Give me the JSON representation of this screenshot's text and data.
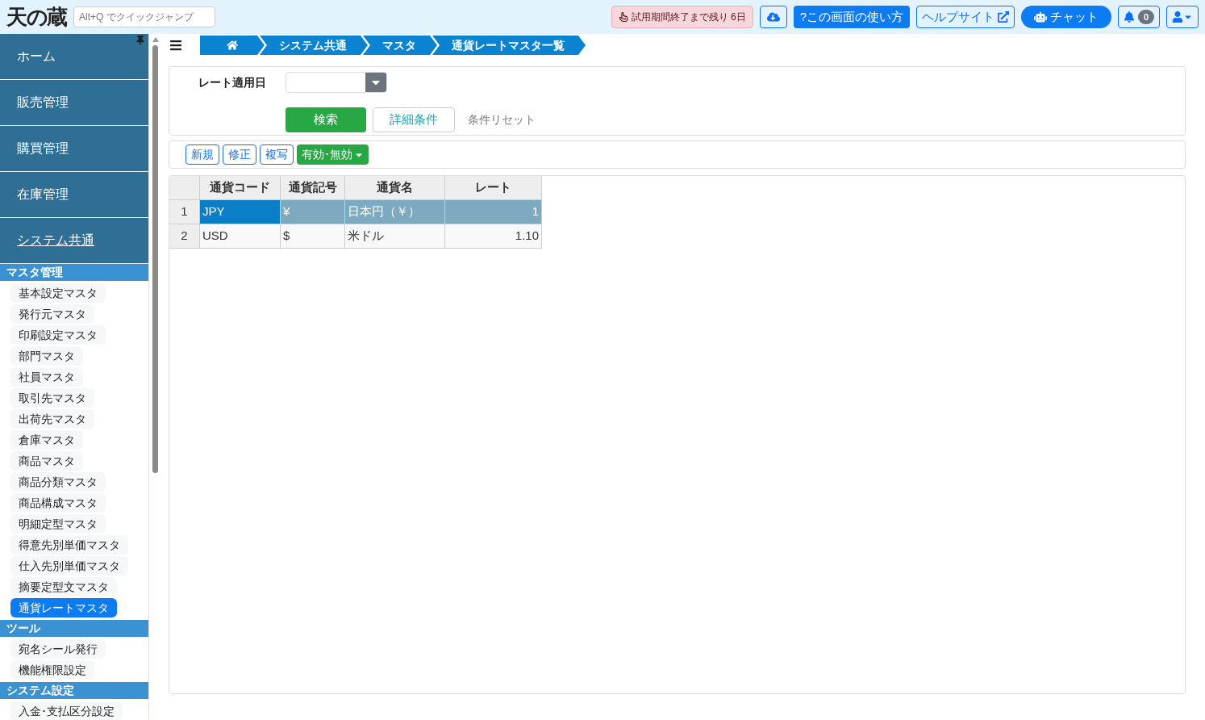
{
  "header": {
    "logo": "天の蔵",
    "quick_jump": {
      "placeholder": "Alt+Q でクイックジャンプ"
    },
    "trial_badge": "試用期間終了まで残り 6日",
    "help_button": "?この画面の使い方",
    "help_site": "ヘルプサイト",
    "chat": "チャット",
    "notifications": "0"
  },
  "sidebar": {
    "menu": [
      {
        "label": "ホーム",
        "selected": false
      },
      {
        "label": "販売管理",
        "selected": false
      },
      {
        "label": "購買管理",
        "selected": false
      },
      {
        "label": "在庫管理",
        "selected": false
      },
      {
        "label": "システム共通",
        "selected": true
      }
    ],
    "sections": [
      {
        "title": "マスタ管理",
        "items": [
          {
            "label": "基本設定マスタ",
            "selected": false
          },
          {
            "label": "発行元マスタ",
            "selected": false
          },
          {
            "label": "印刷設定マスタ",
            "selected": false
          },
          {
            "label": "部門マスタ",
            "selected": false
          },
          {
            "label": "社員マスタ",
            "selected": false
          },
          {
            "label": "取引先マスタ",
            "selected": false
          },
          {
            "label": "出荷先マスタ",
            "selected": false
          },
          {
            "label": "倉庫マスタ",
            "selected": false
          },
          {
            "label": "商品マスタ",
            "selected": false
          },
          {
            "label": "商品分類マスタ",
            "selected": false
          },
          {
            "label": "商品構成マスタ",
            "selected": false
          },
          {
            "label": "明細定型マスタ",
            "selected": false
          },
          {
            "label": "得意先別単価マスタ",
            "selected": false
          },
          {
            "label": "仕入先別単価マスタ",
            "selected": false
          },
          {
            "label": "摘要定型文マスタ",
            "selected": false
          },
          {
            "label": "通貨レートマスタ",
            "selected": true
          }
        ]
      },
      {
        "title": "ツール",
        "items": [
          {
            "label": "宛名シール発行",
            "selected": false
          },
          {
            "label": "機能権限設定",
            "selected": false
          }
        ]
      },
      {
        "title": "システム設定",
        "items": [
          {
            "label": "入金･支払区分設定",
            "selected": false
          }
        ]
      }
    ]
  },
  "breadcrumb": [
    "システム共通",
    "マスタ",
    "通貨レートマスタ一覧"
  ],
  "filter": {
    "label": "レート適用日",
    "search_button": "検索",
    "detail_button": "詳細条件",
    "reset_link": "条件リセット"
  },
  "toolbar": [
    "新規",
    "修正",
    "複写"
  ],
  "toggle_menu": "有効･無効",
  "table": {
    "columns": [
      "通貨コード",
      "通貨記号",
      "通貨名",
      "レート"
    ],
    "rows": [
      {
        "number": "1",
        "selected": true,
        "cells": [
          "JPY",
          "¥",
          "日本円（￥）",
          "1"
        ]
      },
      {
        "number": "2",
        "selected": false,
        "cells": [
          "USD",
          "$",
          "米ドル",
          "1.10"
        ]
      }
    ]
  }
}
